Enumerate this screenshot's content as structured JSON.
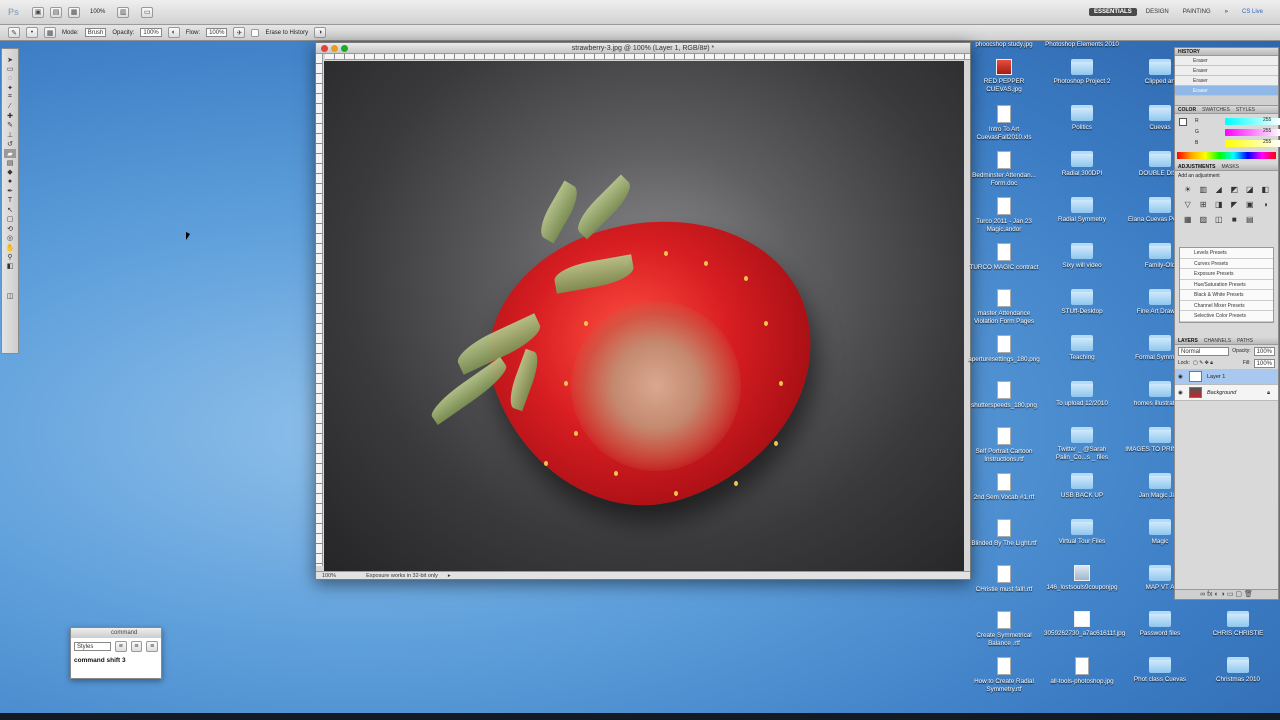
{
  "optionsbar_top": {
    "ps_logo": "Ps",
    "zoom": "100%",
    "workspaces": [
      "ESSENTIALS",
      "DESIGN",
      "PAINTING"
    ],
    "more": "»",
    "cs_live": "CS Live"
  },
  "eraser_options": {
    "mode_label": "Mode:",
    "mode_value": "Brush",
    "opacity_label": "Opacity:",
    "opacity_value": "100%",
    "flow_label": "Flow:",
    "flow_value": "100%",
    "erase_history_label": "Erase to History"
  },
  "document": {
    "title": "strawberry-3.jpg @ 100% (Layer 1, RGB/8#) *",
    "status_zoom": "100%",
    "status_text": "Exposure works in 32-bit only"
  },
  "command_palette": {
    "title": "command",
    "styles_label": "Styles",
    "text": "command shift 3"
  },
  "history": {
    "tab": "HISTORY",
    "items": [
      "Eraser",
      "Eraser",
      "Eraser",
      "Eraser"
    ]
  },
  "color": {
    "tabs": [
      "COLOR",
      "SWATCHES",
      "STYLES"
    ],
    "labels": [
      "R",
      "G",
      "B"
    ],
    "values": [
      "255",
      "255",
      "255"
    ]
  },
  "adjustments": {
    "tabs": [
      "ADJUSTMENTS",
      "MASKS"
    ],
    "hint": "Add an adjustment",
    "presets": [
      "Levels Presets",
      "Curves Presets",
      "Exposure Presets",
      "Hue/Saturation Presets",
      "Black & White Presets",
      "Channel Mixer Presets",
      "Selective Color Presets"
    ]
  },
  "layers": {
    "tabs": [
      "LAYERS",
      "CHANNELS",
      "PATHS"
    ],
    "blend_mode": "Normal",
    "opacity_label": "Opacity:",
    "opacity_value": "100%",
    "lock_label": "Lock:",
    "fill_label": "Fill:",
    "fill_value": "100%",
    "items": [
      "Layer 1",
      "Background"
    ]
  },
  "desktop": {
    "col1": [
      "RED PEPPER CUEVAS.jpg",
      "Intro To Art CuevasFall2010.xls",
      "Bedminster Attendan... Form.doc",
      "Turco 2011 - Jan 23 Magic.andor",
      "TURCO MAGIC contract",
      "master Attendance Violation Form Pages",
      "aperturesettings_180.png",
      "shutterspeeds_180.png",
      "Self Portrait Cartoon Instructions.rtf",
      "2nd Sem Vocab #1.rtf",
      "Blinded By The Light.rtf",
      "CHristie must fall!.rtf",
      "Create Symmetrical Balance .rtf",
      "How to Create Radial Symmetry.rtf"
    ],
    "col2": [
      "Photoshop Project 2",
      "Politics",
      "Radial 300DPI",
      "Radial Symmetry",
      "Sixy will video",
      "STUff-Desktop",
      "Teaching",
      "To upload 12/2010",
      "Twitter _ @Sarah Palin_Co...s _ files",
      "USB BACK UP",
      "Virtual Tour Files",
      "146_lostsouls9couponjpg",
      "3059262730_a7ac61611f.jpg",
      "all-tools-photoshop.jpg"
    ],
    "col3": [
      "Clipped art",
      "Cuevas",
      "DOUBLE DISK",
      "Elana Cuevas Portfolio",
      "Family-Old",
      "Fine Art Drawing",
      "Formal Symmetry",
      "homes illustrations",
      "IMAGES TO PRINT2010",
      "Jan Magic Jam",
      "Magic",
      "MAP VT A",
      "Password files",
      "Phot class Cuevas"
    ],
    "col4": [
      "samples",
      "CHRIS CHRISTIE",
      "Christmas 2010"
    ],
    "top_partial": [
      "phoocshop study.jpg",
      "Photoshop Elements 2010"
    ]
  }
}
